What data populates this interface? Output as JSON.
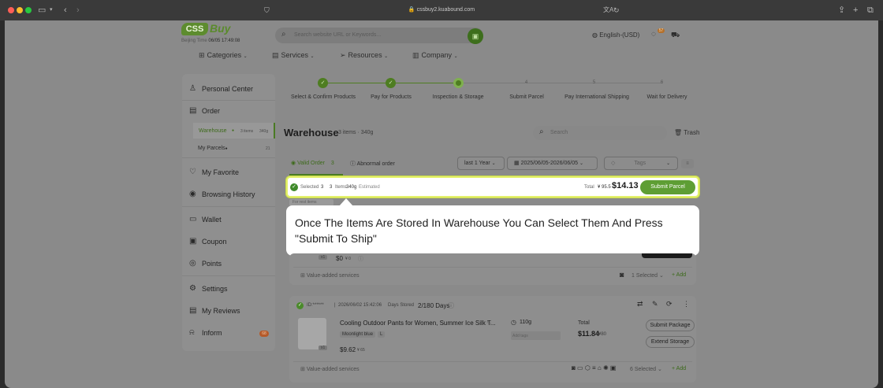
{
  "browser": {
    "url": "cssbuy2.kuabound.com",
    "colors": {
      "red": "#ff5f57",
      "yellow": "#febc2e",
      "green": "#28c840"
    }
  },
  "header": {
    "logo_mark": "CSS",
    "logo_text": "Buy",
    "beijing_time_label": "Beijing Time",
    "beijing_time": "06/05 17:49:08",
    "search_placeholder": "Search website URL or Keywords...",
    "language": "English-(USD)",
    "msg_count": "57"
  },
  "nav": {
    "categories": "Categories",
    "services": "Services",
    "resources": "Resources",
    "company": "Company"
  },
  "sidebar": {
    "personal_center": "Personal Center",
    "order": "Order",
    "warehouse": "Warehouse",
    "warehouse_items": "3 items",
    "warehouse_weight": "340g",
    "my_parcels": "My Parcels",
    "my_parcels_count": "21",
    "my_favorite": "My Favorite",
    "browsing_history": "Browsing History",
    "wallet": "Wallet",
    "coupon": "Coupon",
    "points": "Points",
    "settings": "Settings",
    "my_reviews": "My Reviews",
    "inform": "Inform",
    "inform_count": "68"
  },
  "steps": [
    {
      "label": "Select & Confirm Products",
      "state": "done"
    },
    {
      "label": "Pay for Products",
      "state": "done"
    },
    {
      "label": "Inspection & Storage",
      "state": "current"
    },
    {
      "label": "Submit Parcel",
      "num": "4"
    },
    {
      "label": "Pay International Shipping",
      "num": "5"
    },
    {
      "label": "Wait for Delivery",
      "num": "6"
    }
  ],
  "warehouse": {
    "title": "Warehouse",
    "items": "3 items",
    "weight": "340g",
    "search_placeholder": "Search",
    "trash": "Trash"
  },
  "tabs": {
    "valid_order": "Valid Order",
    "valid_count": "3",
    "abnormal": "Abnormal order"
  },
  "filters": {
    "period": "last 1 Year",
    "date_range": "2025/06/05-2026/06/05",
    "tags": "Tags"
  },
  "selection": {
    "selected_label": "Selected",
    "selected_count": "3",
    "items": "3",
    "items_label": "Items",
    "weight": "340g",
    "estimated": "Estimated",
    "total_label": "Total",
    "total_cny": "¥ 95.5",
    "total_usd": "$14.13",
    "submit": "Submit Parcel"
  },
  "hint_strip": "For rest items",
  "callout": {
    "text": "Once The Items Are Stored In Warehouse You Can Select Them And Press \"Submit To Ship\""
  },
  "card1": {
    "qty": "x1",
    "price": "$0",
    "price_cny": "¥ 0",
    "vas": "Value-added services",
    "selected": "1 Selected",
    "add": "Add"
  },
  "card2": {
    "id": "ID:******",
    "stored_date": "2026/06/02 15:42:06",
    "days_label": "Days Stored",
    "days": "2/180 Days",
    "product": "Cooling Outdoor Pants for Women, Summer Ice Silk T...",
    "color": "Moonlight blue",
    "size": "L",
    "weight": "110g",
    "tag_ph": "Add tags",
    "total_label": "Total",
    "total": "$11.84",
    "total_cny": "¥80",
    "price": "$9.62",
    "price_cny": "¥ 65",
    "qty": "x1",
    "submit_package": "Submit Package",
    "extend_storage": "Extend Storage",
    "vas": "Value-added services",
    "selected": "6 Selected",
    "add": "Add"
  }
}
